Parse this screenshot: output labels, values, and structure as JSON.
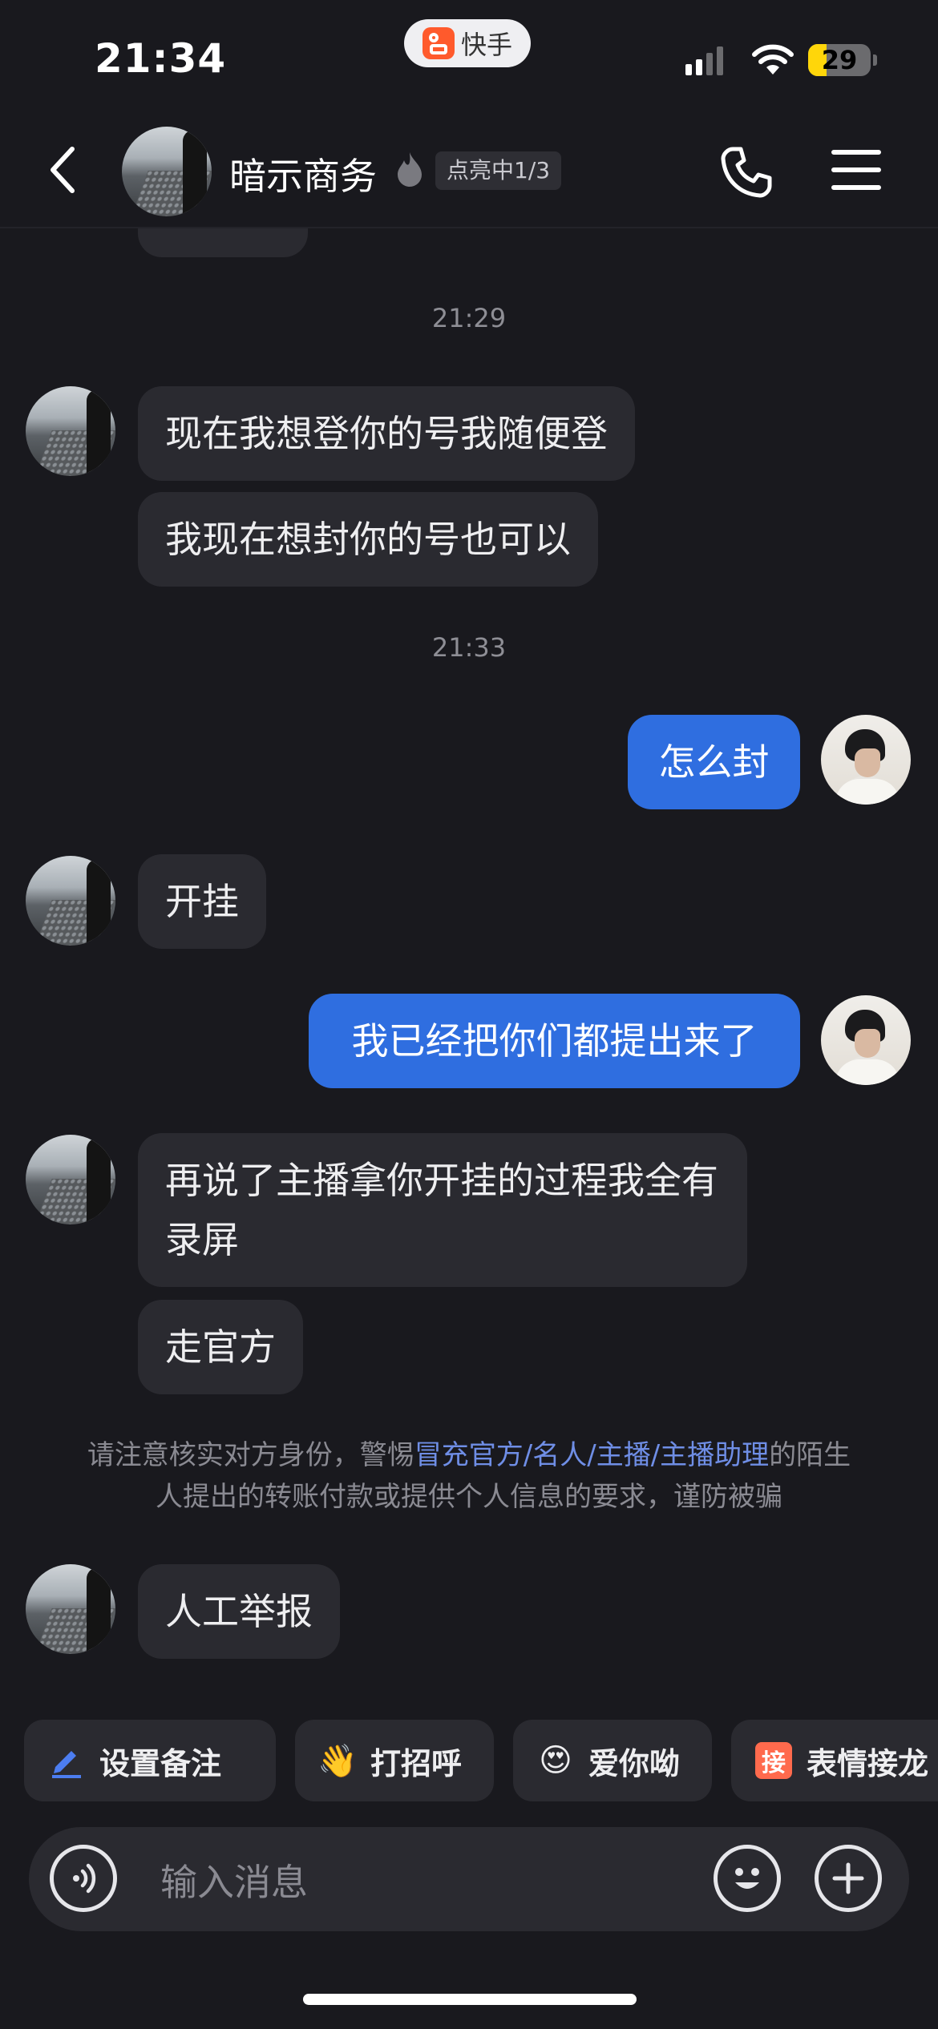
{
  "status_bar": {
    "time": "21:34",
    "app_name": "快手",
    "battery": "29",
    "battery_level": 0.29
  },
  "header": {
    "title": "暗示商务",
    "badge": "点亮中1/3"
  },
  "messages": {
    "stamp1": "21:29",
    "m1": "现在我想登你的号我随便登",
    "m2": "我现在想封你的号也可以",
    "stamp2": "21:33",
    "m3": "怎么封",
    "m4": "开挂",
    "m5": "我已经把你们都提出来了",
    "m6": "再说了主播拿你开挂的过程我全有录屏",
    "m7": "走官方",
    "m8": "人工举报"
  },
  "notice": {
    "before": "请注意核实对方身份，警惕",
    "highlight": "冒充官方/名人/主播/主播助理",
    "after": "的陌生人提出的转账付款或提供个人信息的要求，谨防被骗"
  },
  "quick_chips": {
    "remark": "设置备注",
    "greet": "打招呼",
    "love": "爱你呦",
    "jielong_icon": "接",
    "jielong": "表情接龙"
  },
  "input": {
    "placeholder": "输入消息"
  },
  "icons": {
    "back": "chevron-left-icon",
    "call": "phone-icon",
    "menu": "hamburger-menu-icon",
    "voice": "voice-icon",
    "emoji": "emoji-icon",
    "plus": "plus-icon"
  },
  "colors": {
    "background": "#19191e",
    "incoming_bubble": "#2a2a30",
    "outgoing_bubble": "#2f6ee0",
    "notice_highlight": "#6f8ee6"
  }
}
